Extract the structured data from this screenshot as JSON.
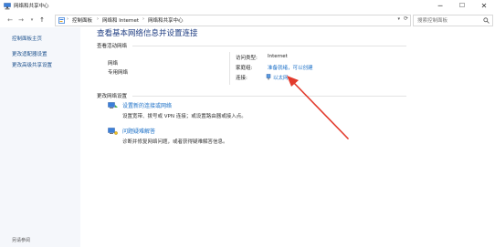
{
  "window": {
    "title": "网络和共享中心",
    "minimize": "─",
    "maximize": "☐",
    "close": "✕"
  },
  "nav": {
    "back": "←",
    "forward": "→",
    "up": "↑",
    "breadcrumbs": [
      "控制面板",
      "网络和 Internet",
      "网络和共享中心"
    ],
    "refresh": "⟳",
    "search_placeholder": "搜索控制面板"
  },
  "sidebar": {
    "items": [
      {
        "label": "控制面板主页"
      },
      {
        "label": "更改适配器设置"
      },
      {
        "label": "更改高级共享设置"
      }
    ],
    "see_also": "另请参阅"
  },
  "main": {
    "title": "查看基本网络信息并设置连接",
    "active_section": "查看活动网络",
    "network_name": "网络",
    "network_type": "专用网络",
    "access_type_label": "访问类型:",
    "access_type_value": "Internet",
    "homegroup_label": "家庭组:",
    "homegroup_value": "准备就绪，可以创建",
    "connection_label": "连接:",
    "connection_value": "以太网",
    "change_section": "更改网络设置",
    "tasks": [
      {
        "title": "设置新的连接或网络",
        "desc": "设置宽带、拨号或 VPN 连接；或设置路由器或接入点。"
      },
      {
        "title": "问题疑难解答",
        "desc": "诊断并修复网络问题，或者获得疑难解答信息。"
      }
    ]
  },
  "colors": {
    "link": "#1a6fc7",
    "title": "#1e3c82",
    "sidebar_bg": "#f5f7fb",
    "arrow": "#e23a2c"
  }
}
